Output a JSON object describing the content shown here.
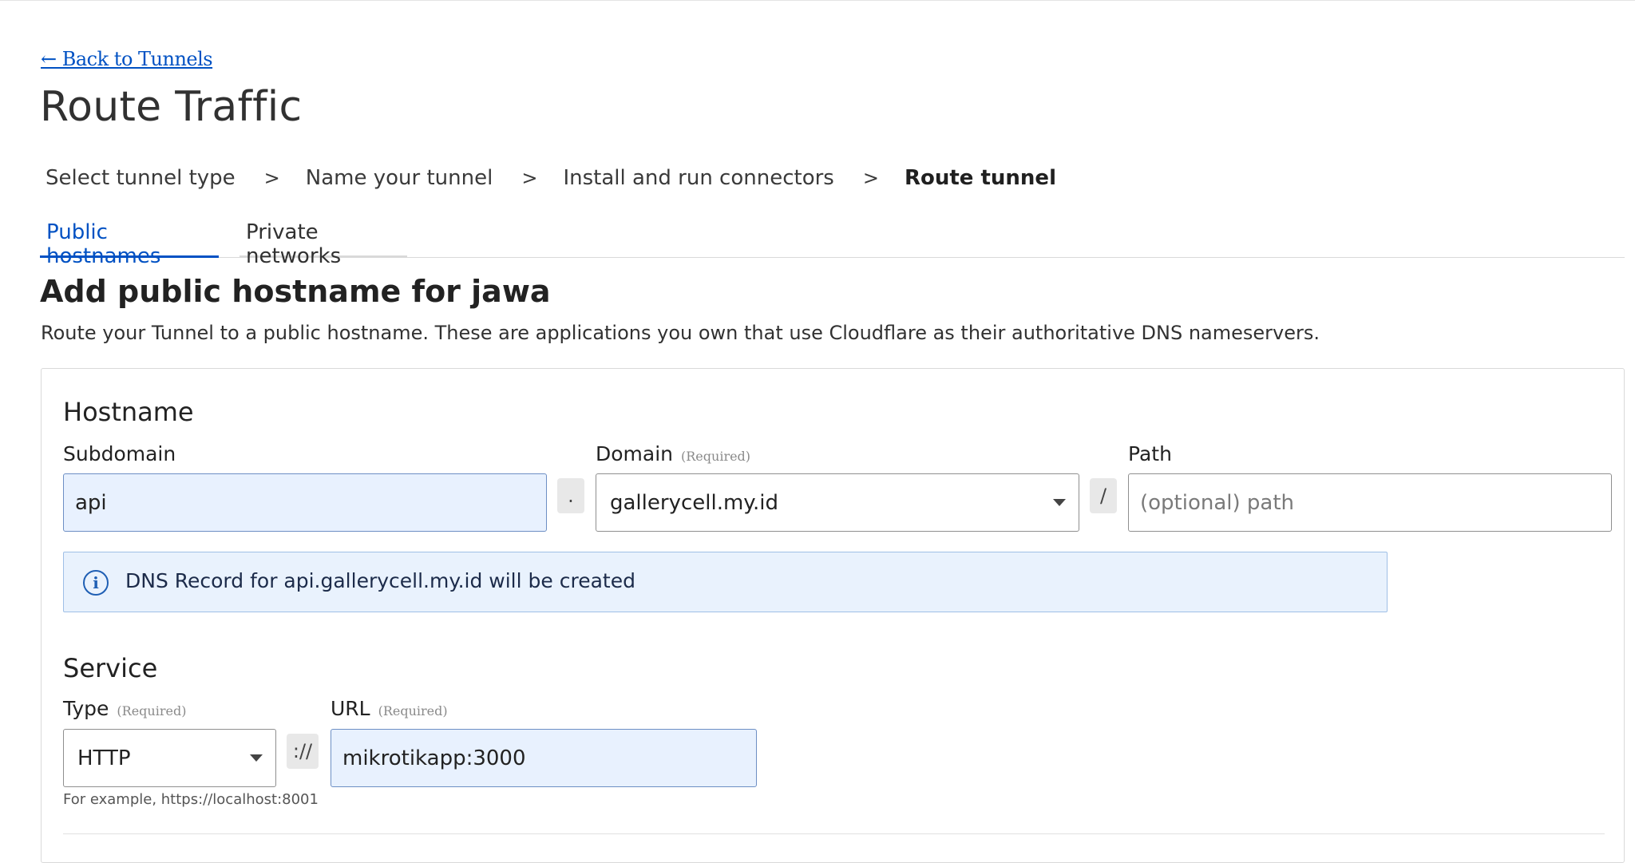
{
  "nav": {
    "back_link": "← Back to Tunnels"
  },
  "page": {
    "title": "Route Traffic"
  },
  "steps": [
    {
      "label": "Select tunnel type"
    },
    {
      "label": "Name your tunnel"
    },
    {
      "label": "Install and run connectors"
    },
    {
      "label": "Route tunnel"
    }
  ],
  "step_separator": ">",
  "tabs": [
    {
      "label": "Public hostnames",
      "active": true
    },
    {
      "label": "Private networks",
      "active": false
    }
  ],
  "section": {
    "title": "Add public hostname for jawa",
    "description": "Route your Tunnel to a public hostname. These are applications you own that use Cloudflare as their authoritative DNS nameservers."
  },
  "hostname": {
    "title": "Hostname",
    "subdomain_label": "Subdomain",
    "subdomain_value": "api",
    "dot_separator": ".",
    "domain_label": "Domain",
    "domain_required": "(Required)",
    "domain_value": "gallerycell.my.id",
    "slash_separator": "/",
    "path_label": "Path",
    "path_placeholder": "(optional) path",
    "info_text": "DNS Record for api.gallerycell.my.id will be created"
  },
  "service": {
    "title": "Service",
    "type_label": "Type",
    "type_required": "(Required)",
    "type_value": "HTTP",
    "scheme_separator": "://",
    "url_label": "URL",
    "url_required": "(Required)",
    "url_value": "mikrotikapp:3000",
    "hint": "For example, https://localhost:8001"
  },
  "colors": {
    "link": "#0051c3",
    "filled_input_bg": "#e8f1fe",
    "info_bg": "#e9f2fd"
  }
}
